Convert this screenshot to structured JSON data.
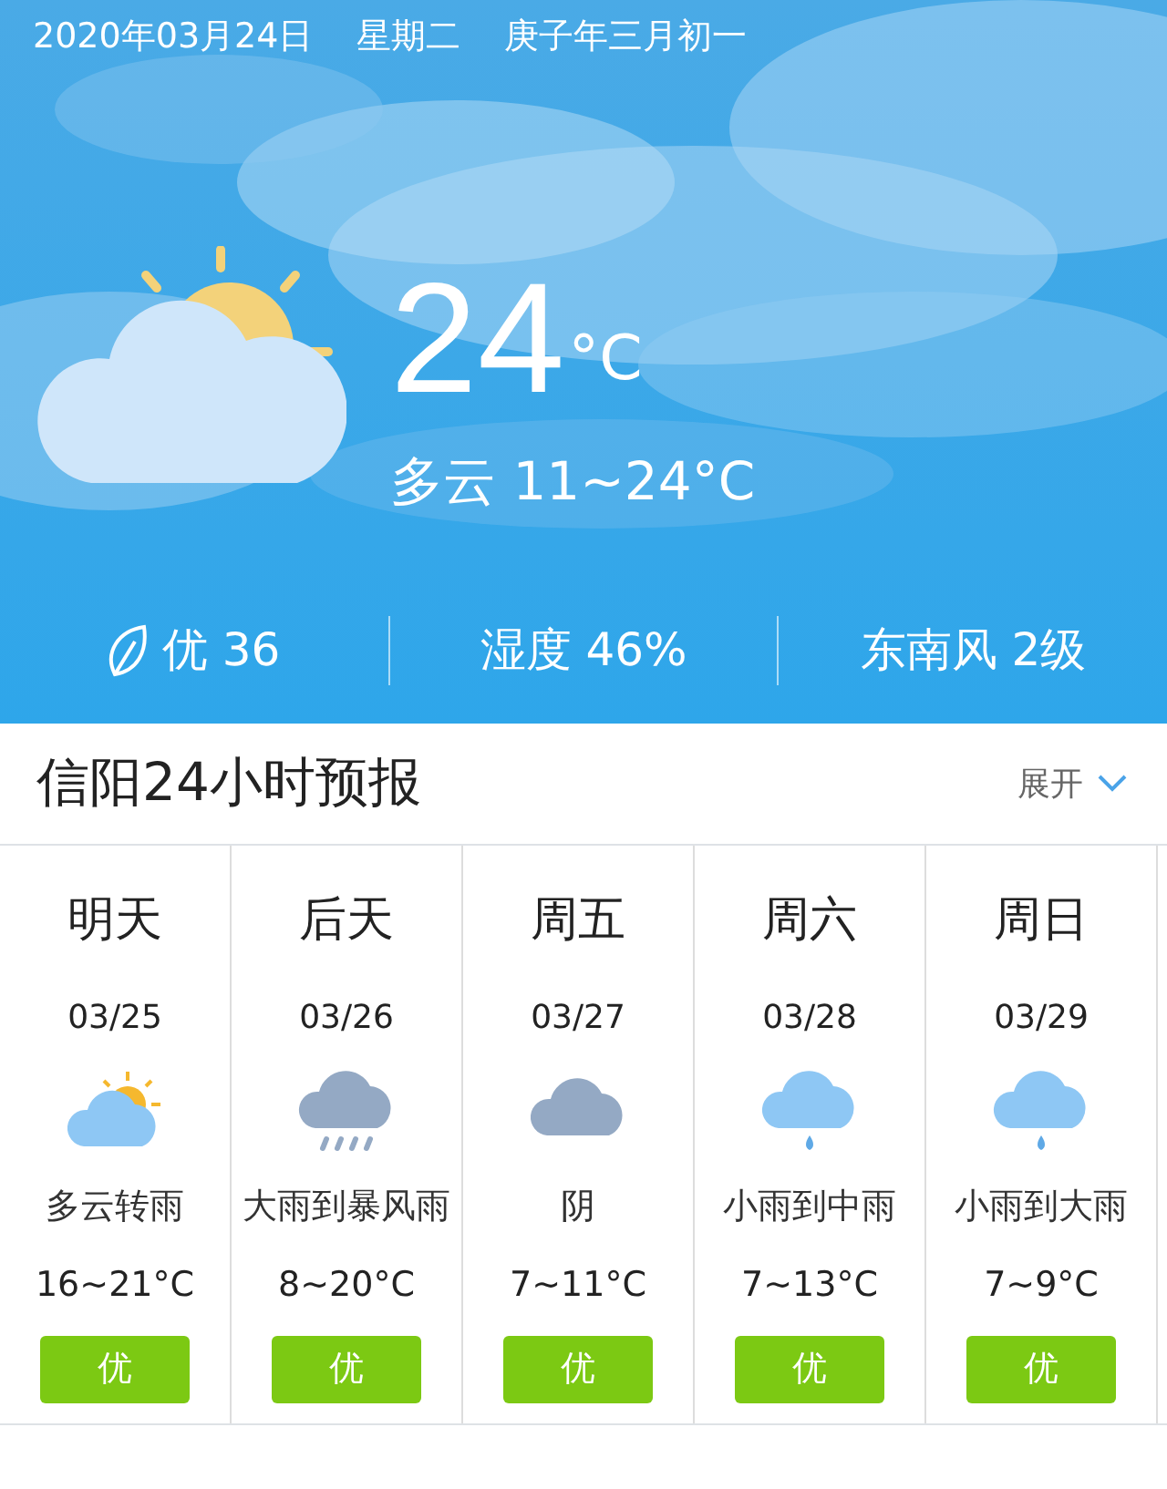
{
  "header": {
    "date": "2020年03月24日",
    "weekday": "星期二",
    "lunar": "庚子年三月初一"
  },
  "current": {
    "temp": "24",
    "unit": "°C",
    "summary": "多云 11~24°C"
  },
  "stats": [
    {
      "kind": "aqi",
      "text": "优 36"
    },
    {
      "kind": "plain",
      "text": "湿度 46%"
    },
    {
      "kind": "plain",
      "text": "东南风 2级"
    }
  ],
  "forecast": {
    "title": "信阳24小时预报",
    "toggle": "展开",
    "days": [
      {
        "day": "明天",
        "date": "03/25",
        "kind": "sun-cloud",
        "weather": "多云转雨",
        "temp": "16~21°C",
        "aqi": "优"
      },
      {
        "day": "后天",
        "date": "03/26",
        "kind": "heavy-rain",
        "weather": "大雨到暴风雨",
        "temp": "8~20°C",
        "aqi": "优"
      },
      {
        "day": "周五",
        "date": "03/27",
        "kind": "overcast",
        "weather": "阴",
        "temp": "7~11°C",
        "aqi": "优"
      },
      {
        "day": "周六",
        "date": "03/28",
        "kind": "light-rain",
        "weather": "小雨到中雨",
        "temp": "7~13°C",
        "aqi": "优"
      },
      {
        "day": "周日",
        "date": "03/29",
        "kind": "light-rain",
        "weather": "小雨到大雨",
        "temp": "7~9°C",
        "aqi": "优"
      }
    ]
  }
}
